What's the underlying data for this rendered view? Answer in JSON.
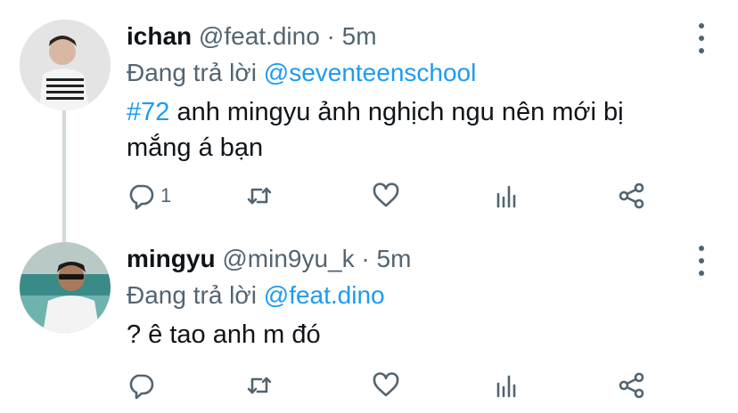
{
  "tweets": [
    {
      "name": "ichan",
      "handle": "@feat.dino",
      "dot": "·",
      "time": "5m",
      "reply_prefix": "Đang trả lời",
      "reply_to": "@seventeenschool",
      "hashtag": "#72",
      "text": " anh mingyu ảnh nghịch ngu nên mới bị mắng á bạn",
      "reply_count": "1"
    },
    {
      "name": "mingyu",
      "handle": "@min9yu_k",
      "dot": "·",
      "time": "5m",
      "reply_prefix": "Đang trả lời",
      "reply_to": "@feat.dino",
      "text": "? ê tao anh m đó"
    }
  ],
  "icons": {
    "reply": "reply-icon",
    "retweet": "retweet-icon",
    "like": "heart-icon",
    "analytics": "analytics-icon",
    "share": "share-icon",
    "more": "more-icon"
  },
  "colors": {
    "link": "#1d9bf0",
    "secondary": "#536471",
    "thread_line": "#cfd9de"
  }
}
